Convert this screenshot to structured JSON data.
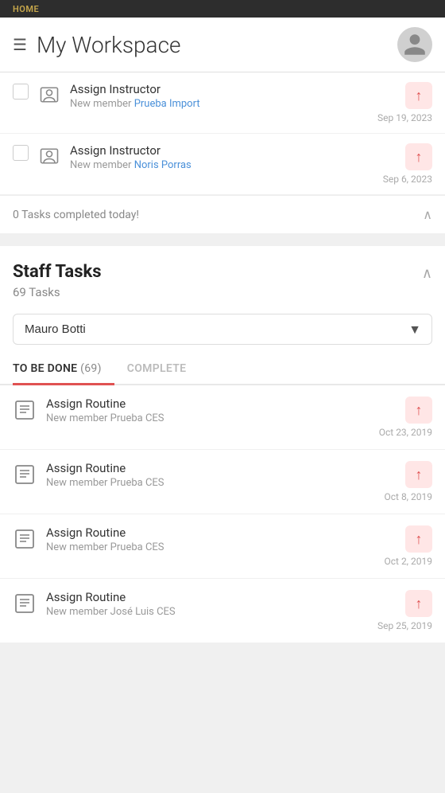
{
  "topBar": {
    "homeLabel": "HOME"
  },
  "header": {
    "title": "My Workspace",
    "menuIcon": "☰",
    "avatarAlt": "User Avatar"
  },
  "myTasks": {
    "items": [
      {
        "title": "Assign Instructor",
        "subtitlePrefix": "New member",
        "subtitleLink": "Prueba Import",
        "date": "Sep 19, 2023",
        "priority": "high"
      },
      {
        "title": "Assign Instructor",
        "subtitlePrefix": "New member",
        "subtitleLink": "Noris Porras",
        "date": "Sep 6, 2023",
        "priority": "high"
      }
    ],
    "completedToday": "0 Tasks completed today!"
  },
  "staffTasks": {
    "sectionTitle": "Staff Tasks",
    "taskCount": "69 Tasks",
    "dropdownOptions": [
      "Mauro Botti"
    ],
    "dropdownSelected": "Mauro Botti",
    "tabs": [
      {
        "label": "TO BE DONE",
        "count": "(69)",
        "active": true
      },
      {
        "label": "COMPLETE",
        "count": "",
        "active": false
      }
    ],
    "items": [
      {
        "title": "Assign Routine",
        "subtitle": "New member Prueba CES",
        "date": "Oct 23, 2019",
        "priority": "high"
      },
      {
        "title": "Assign Routine",
        "subtitle": "New member Prueba CES",
        "date": "Oct 8, 2019",
        "priority": "high"
      },
      {
        "title": "Assign Routine",
        "subtitle": "New member Prueba CES",
        "date": "Oct 2, 2019",
        "priority": "high"
      },
      {
        "title": "Assign Routine",
        "subtitle": "New member José Luis CES",
        "date": "Sep 25, 2019",
        "priority": "high"
      }
    ]
  },
  "icons": {
    "instructor": "👤",
    "routine": "📋",
    "upArrow": "↑",
    "chevronUp": "∧",
    "chevronDown": "∨"
  }
}
